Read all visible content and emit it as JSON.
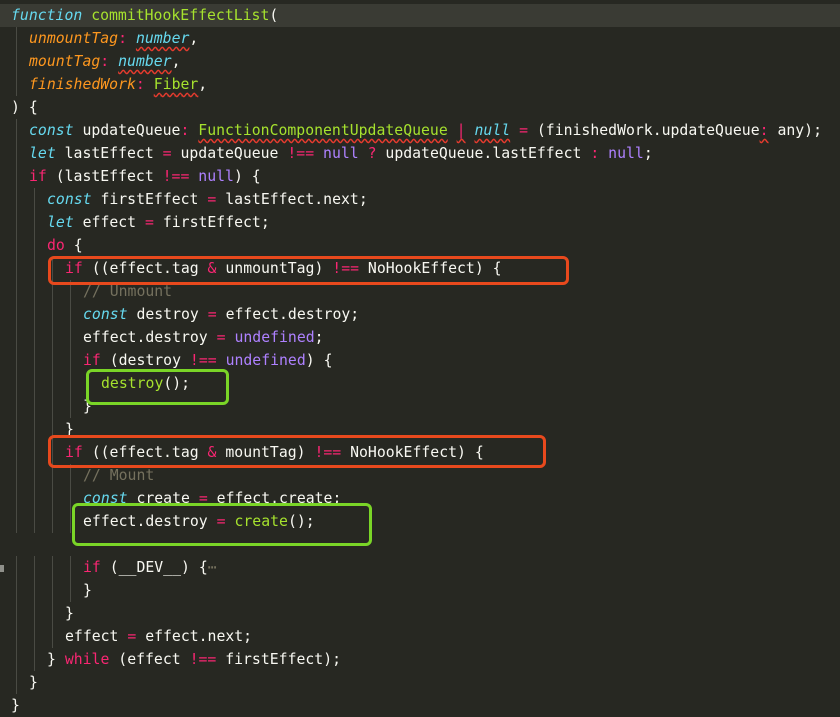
{
  "editor": {
    "lines": [
      {
        "indent": 0,
        "tokens": [
          [
            "kw",
            "function"
          ],
          [
            "txt",
            " "
          ],
          [
            "fn",
            "commitHookEffectList"
          ],
          [
            "txt",
            "("
          ]
        ]
      },
      {
        "indent": 1,
        "tokens": [
          [
            "prm",
            "unmountTag"
          ],
          [
            "op",
            ":"
          ],
          [
            "txt",
            " "
          ],
          [
            "typ sq",
            "number"
          ],
          [
            "txt",
            ","
          ]
        ]
      },
      {
        "indent": 1,
        "tokens": [
          [
            "prm",
            "mountTag"
          ],
          [
            "op",
            ":"
          ],
          [
            "txt",
            " "
          ],
          [
            "typ sq",
            "number"
          ],
          [
            "txt",
            ","
          ]
        ]
      },
      {
        "indent": 1,
        "tokens": [
          [
            "prm",
            "finishedWork"
          ],
          [
            "op",
            ":"
          ],
          [
            "txt",
            " "
          ],
          [
            "cls sq",
            "Fiber"
          ],
          [
            "txt",
            ","
          ]
        ]
      },
      {
        "indent": 0,
        "tokens": [
          [
            "txt",
            ") {"
          ]
        ]
      },
      {
        "indent": 1,
        "tokens": [
          [
            "kw",
            "const"
          ],
          [
            "txt",
            " updateQueue"
          ],
          [
            "op",
            ":"
          ],
          [
            "txt",
            " "
          ],
          [
            "cls sq",
            "FunctionComponentUpdateQueue"
          ],
          [
            "txt",
            " "
          ],
          [
            "op sq",
            "|"
          ],
          [
            "txt",
            " "
          ],
          [
            "kw sq",
            "null"
          ],
          [
            "txt",
            " "
          ],
          [
            "op",
            "="
          ],
          [
            "txt",
            " (finishedWork.updateQueue"
          ],
          [
            "op sq",
            ":"
          ],
          [
            "txt",
            " any);"
          ]
        ]
      },
      {
        "indent": 1,
        "tokens": [
          [
            "kw",
            "let"
          ],
          [
            "txt",
            " lastEffect "
          ],
          [
            "op",
            "="
          ],
          [
            "txt",
            " updateQueue "
          ],
          [
            "op",
            "!=="
          ],
          [
            "txt",
            " "
          ],
          [
            "cst",
            "null"
          ],
          [
            "txt",
            " "
          ],
          [
            "op",
            "?"
          ],
          [
            "txt",
            " updateQueue.lastEffect "
          ],
          [
            "op",
            ":"
          ],
          [
            "txt",
            " "
          ],
          [
            "cst",
            "null"
          ],
          [
            "txt",
            ";"
          ]
        ]
      },
      {
        "indent": 1,
        "tokens": [
          [
            "ctl",
            "if"
          ],
          [
            "txt",
            " (lastEffect "
          ],
          [
            "op",
            "!=="
          ],
          [
            "txt",
            " "
          ],
          [
            "cst",
            "null"
          ],
          [
            "txt",
            ") {"
          ]
        ]
      },
      {
        "indent": 2,
        "tokens": [
          [
            "kw",
            "const"
          ],
          [
            "txt",
            " firstEffect "
          ],
          [
            "op",
            "="
          ],
          [
            "txt",
            " lastEffect.next;"
          ]
        ]
      },
      {
        "indent": 2,
        "tokens": [
          [
            "kw",
            "let"
          ],
          [
            "txt",
            " effect "
          ],
          [
            "op",
            "="
          ],
          [
            "txt",
            " firstEffect;"
          ]
        ]
      },
      {
        "indent": 2,
        "tokens": [
          [
            "ctl",
            "do"
          ],
          [
            "txt",
            " {"
          ]
        ]
      },
      {
        "indent": 3,
        "tokens": [
          [
            "ctl",
            "if"
          ],
          [
            "txt",
            " ((effect.tag "
          ],
          [
            "op",
            "&"
          ],
          [
            "txt",
            " unmountTag) "
          ],
          [
            "op",
            "!=="
          ],
          [
            "txt",
            " NoHookEffect) {"
          ]
        ]
      },
      {
        "indent": 4,
        "tokens": [
          [
            "cmt",
            "// Unmount"
          ]
        ]
      },
      {
        "indent": 4,
        "tokens": [
          [
            "kw",
            "const"
          ],
          [
            "txt",
            " destroy "
          ],
          [
            "op",
            "="
          ],
          [
            "txt",
            " effect.destroy;"
          ]
        ]
      },
      {
        "indent": 4,
        "tokens": [
          [
            "txt",
            "effect.destroy "
          ],
          [
            "op",
            "="
          ],
          [
            "txt",
            " "
          ],
          [
            "cst",
            "undefined"
          ],
          [
            "txt",
            ";"
          ]
        ]
      },
      {
        "indent": 4,
        "tokens": [
          [
            "ctl",
            "if"
          ],
          [
            "txt",
            " (destroy "
          ],
          [
            "op",
            "!=="
          ],
          [
            "txt",
            " "
          ],
          [
            "cst",
            "undefined"
          ],
          [
            "txt",
            ") {"
          ]
        ]
      },
      {
        "indent": 5,
        "tokens": [
          [
            "fn",
            "destroy"
          ],
          [
            "txt",
            "();"
          ]
        ]
      },
      {
        "indent": 4,
        "tokens": [
          [
            "txt",
            "}"
          ]
        ]
      },
      {
        "indent": 3,
        "tokens": [
          [
            "txt",
            "}"
          ]
        ]
      },
      {
        "indent": 3,
        "tokens": [
          [
            "ctl",
            "if"
          ],
          [
            "txt",
            " ((effect.tag "
          ],
          [
            "op",
            "&"
          ],
          [
            "txt",
            " mountTag) "
          ],
          [
            "op",
            "!=="
          ],
          [
            "txt",
            " NoHookEffect) {"
          ]
        ]
      },
      {
        "indent": 4,
        "tokens": [
          [
            "cmt",
            "// Mount"
          ]
        ]
      },
      {
        "indent": 4,
        "tokens": [
          [
            "kw",
            "const"
          ],
          [
            "txt",
            " create "
          ],
          [
            "op",
            "="
          ],
          [
            "txt",
            " effect.create;"
          ]
        ]
      },
      {
        "indent": 4,
        "tokens": [
          [
            "txt",
            "effect.destroy "
          ],
          [
            "op",
            "="
          ],
          [
            "txt",
            " "
          ],
          [
            "fn",
            "create"
          ],
          [
            "txt",
            "();"
          ]
        ]
      },
      {
        "indent": 0,
        "tokens": []
      },
      {
        "indent": 4,
        "tokens": [
          [
            "ctl",
            "if"
          ],
          [
            "txt",
            " (__DEV__) {"
          ],
          [
            "cmt",
            "⋯"
          ]
        ]
      },
      {
        "indent": 4,
        "tokens": [
          [
            "txt",
            "}"
          ]
        ]
      },
      {
        "indent": 3,
        "tokens": [
          [
            "txt",
            "}"
          ]
        ]
      },
      {
        "indent": 3,
        "tokens": [
          [
            "txt",
            "effect "
          ],
          [
            "op",
            "="
          ],
          [
            "txt",
            " effect.next;"
          ]
        ]
      },
      {
        "indent": 2,
        "tokens": [
          [
            "txt",
            "} "
          ],
          [
            "ctl",
            "while"
          ],
          [
            "txt",
            " (effect "
          ],
          [
            "op",
            "!=="
          ],
          [
            "txt",
            " firstEffect);"
          ]
        ]
      },
      {
        "indent": 1,
        "tokens": [
          [
            "txt",
            "}"
          ]
        ]
      },
      {
        "indent": 0,
        "tokens": [
          [
            "txt",
            "}"
          ]
        ]
      }
    ]
  },
  "colors": {
    "background": "#272822",
    "annotation_red": "#e8491d",
    "annotation_green": "#7ad527"
  }
}
